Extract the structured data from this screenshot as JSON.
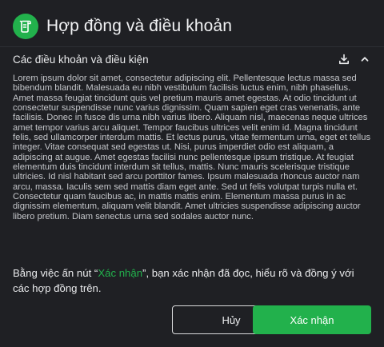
{
  "dialog": {
    "title": "Hợp đồng và điều khoản",
    "logo_icon": "document-scroll-icon",
    "accent_color": "#22b14c"
  },
  "terms_section": {
    "title": "Các điều khoản và điều kiện",
    "download_icon": "download-icon",
    "collapse_icon": "chevron-up-icon",
    "body": "Lorem ipsum dolor sit amet, consectetur adipiscing elit. Pellentesque lectus massa sed bibendum blandit. Malesuada eu nibh vestibulum facilisis luctus enim, nibh phasellus. Amet massa feugiat tincidunt quis vel pretium mauris amet egestas. At odio tincidunt ut consectetur suspendisse nunc varius dignissim. Quam sapien eget cras venenatis, ante facilisis. Donec in fusce dis urna nibh varius libero. Aliquam nisl, maecenas neque ultrices amet tempor varius arcu aliquet. Tempor faucibus ultrices velit enim id. Magna tincidunt felis, sed ullamcorper interdum mattis. Et lectus purus, vitae fermentum urna, eget et tellus integer. Vitae consequat sed egestas ut. Nisi, purus imperdiet odio est aliquam, a adipiscing at augue. Amet egestas facilisi nunc pellentesque ipsum tristique. At feugiat elementum duis tincidunt interdum sit tellus, mattis. Nunc mauris scelerisque tristique ultricies. Id nisl habitant sed arcu porttitor fames. Ipsum malesuada rhoncus auctor nam arcu, massa. Iaculis sem sed mattis diam eget ante. Sed ut felis volutpat turpis nulla et. Consectetur quam faucibus ac, in mattis mattis enim. Elementum massa purus in ac dignissim elementum, aliquam velit blandit. Amet ultricies suspendisse adipiscing auctor libero pretium. Diam senectus urna sed sodales auctor nunc."
  },
  "agreement": {
    "prefix": "Bằng việc ấn nút “",
    "highlight": "Xác nhận",
    "suffix": "”, bạn xác nhận đã đọc, hiểu rõ và đồng ý với các hợp đồng trên."
  },
  "buttons": {
    "cancel_label": "Hủy",
    "confirm_label": "Xác nhận"
  }
}
